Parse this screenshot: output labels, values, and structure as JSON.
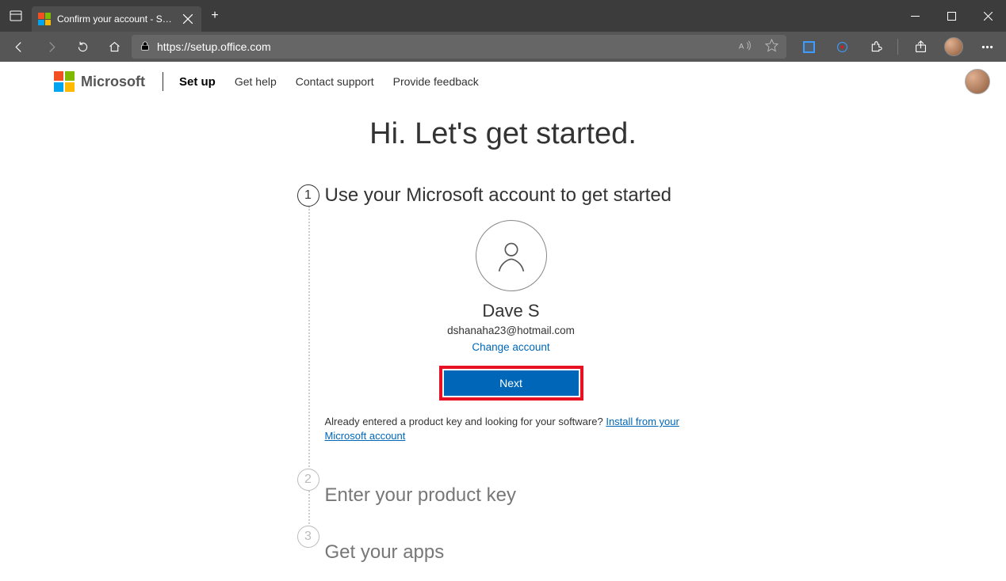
{
  "browser": {
    "tab_title": "Confirm your account - Setup Of",
    "url": "https://setup.office.com"
  },
  "header": {
    "brand": "Microsoft",
    "nav": {
      "setup": "Set up",
      "help": "Get help",
      "contact": "Contact support",
      "feedback": "Provide feedback"
    }
  },
  "heading": "Hi. Let's get started.",
  "steps": {
    "1": {
      "num": "1",
      "title": "Use your Microsoft account to get started"
    },
    "2": {
      "num": "2",
      "title": "Enter your product key"
    },
    "3": {
      "num": "3",
      "title": "Get your apps"
    }
  },
  "account": {
    "name": "Dave S",
    "email": "dshanaha23@hotmail.com",
    "change": "Change account",
    "next": "Next",
    "hint_pre": "Already entered a product key and looking for your software?  ",
    "hint_link": "Install from your Microsoft account"
  }
}
